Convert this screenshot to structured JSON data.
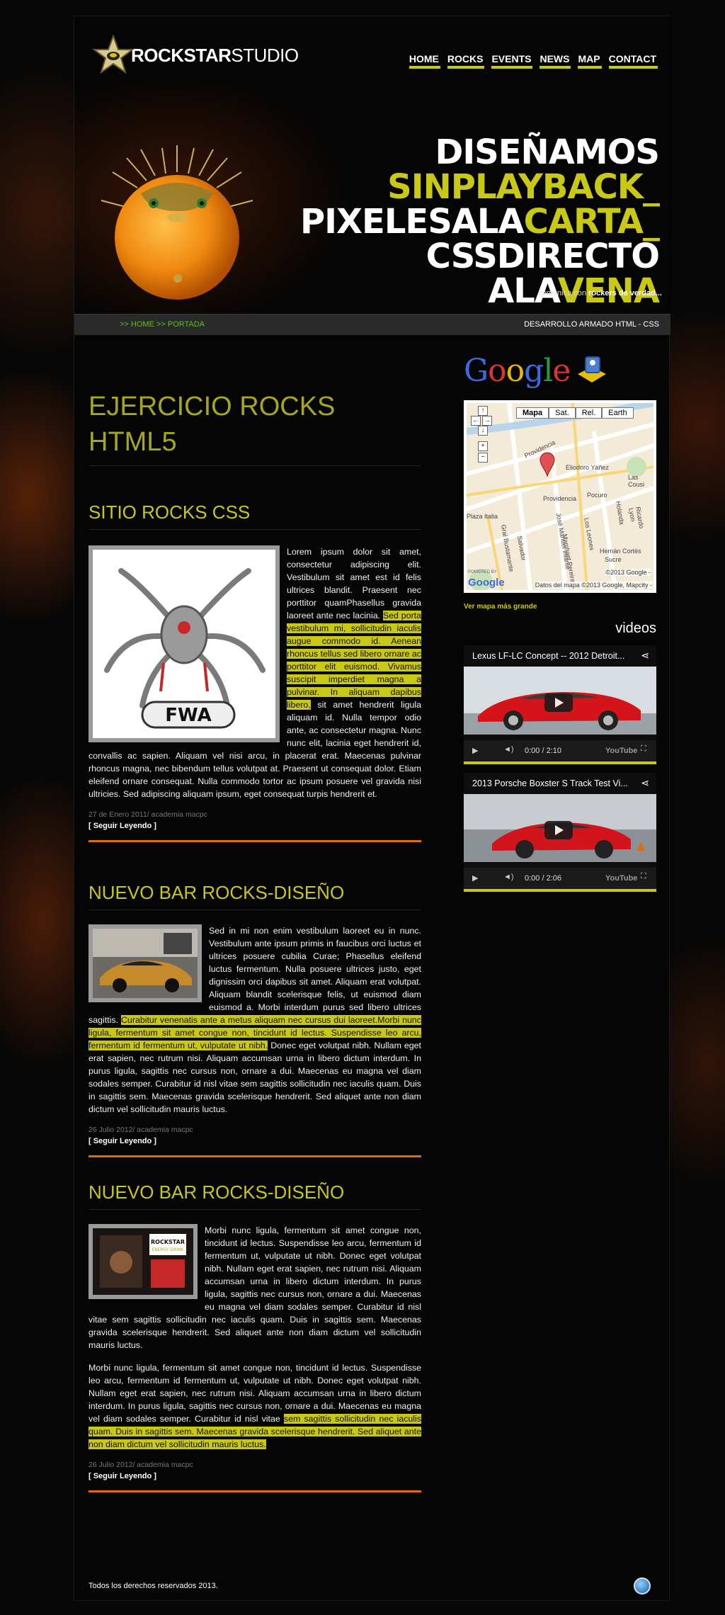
{
  "brand": {
    "logo_part1": "ROCKSTAR",
    "logo_part2": "STUDIO"
  },
  "nav": [
    "HOME",
    "ROCKS",
    "EVENTS",
    "NEWS",
    "MAP",
    "CONTACT"
  ],
  "tagline": {
    "line1": "DISEÑAMOS",
    "line2": "SINPLAYBACK_",
    "line3a": "PIXELESALA",
    "line3b": "CARTA_",
    "line4": "CSSDIRECTO",
    "line5a": "ALA",
    "line5b": "VENA",
    "sub_prefix": "comunica con ",
    "sub_bold": "rockers de verdad..."
  },
  "breadcrumb": {
    "left": ">> HOME >> PORTADA",
    "right": "DESARROLLO ARMADO HTML - CSS"
  },
  "page_title": "EJERCICIO ROCKS HTML5",
  "posts": [
    {
      "title": "SITIO ROCKS CSS",
      "text_before": "Lorem ipsum dolor sit amet, consectetur adipiscing elit. Vestibulum sit amet est id felis ultrices blandit. Praesent nec porttitor quamPhasellus gravida laoreet ante nec lacinia. ",
      "text_highlight": "Sed porta vestibulum mi, sollicitudin iaculis augue commodo id. Aenean rhoncus tellus sed libero ornare ac porttitor elit euismod. Vivamus suscipit imperdiet magna a pulvinar. In aliquam dapibus libero,",
      "text_after": " sit amet hendrerit ligula aliquam id. Nulla tempor odio ante, ac consectetur magna. Nunc nunc elit, lacinia eget hendrerit id, convallis ac sapien. Aliquam vel nisi arcu, in placerat erat. Maecenas pulvinar rhoncus magna, nec bibendum tellus volutpat at. Praesent ut consequat dolor. Etiam eleifend ornare consequat. Nulla commodo tortor ac ipsum posuere vel gravida nisi ultricies. Sed adipiscing aliquam ipsum, eget consequat turpis hendrerit et.",
      "meta": "27 de Enero 2011/ academia macpc",
      "more": "[ Seguir Leyendo ]"
    },
    {
      "title": "NUEVO BAR ROCKS-DISEÑO",
      "text_before": "Sed in mi non enim vestibulum laoreet eu in nunc. Vestibulum ante ipsum primis in faucibus orci luctus et ultrices posuere cubilia Curae; Phasellus eleifend luctus fermentum. Nulla posuere ultrices justo, eget dignissim orci dapibus sit amet. Aliquam erat volutpat. Aliquam blandit scelerisque felis, ut euismod diam euismod a. Morbi interdum purus sed libero ultrices sagittis. ",
      "text_highlight": "Curabitur venenatis ante a metus aliquam nec cursus dui laoreet.Morbi nunc ligula, fermentum sit amet congue non, tincidunt id lectus. Suspendisse leo arcu, fermentum id fermentum ut, vulputate ut nibh.",
      "text_after": " Donec eget volutpat nibh. Nullam eget erat sapien, nec rutrum nisi. Aliquam accumsan urna in libero dictum interdum. In purus ligula, sagittis nec cursus non, ornare a dui. Maecenas eu magna vel diam sodales semper. Curabitur id nisl vitae sem sagittis sollicitudin nec iaculis quam. Duis in sagittis sem. Maecenas gravida scelerisque hendrerit. Sed aliquet ante non diam dictum vel sollicitudin mauris luctus.",
      "meta": "26 Julio 2012/ academia macpc",
      "more": "[ Seguir Leyendo ]"
    },
    {
      "title": "NUEVO BAR ROCKS-DISEÑO",
      "text_p1": "Morbi nunc ligula, fermentum sit amet congue non, tincidunt id lectus. Suspendisse leo arcu, fermentum id fermentum ut, vulputate ut nibh. Donec eget volutpat nibh. Nullam eget erat sapien, nec rutrum nisi. Aliquam accumsan urna in libero dictum interdum. In purus ligula, sagittis nec cursus non, ornare a dui. Maecenas eu magna vel diam sodales semper. Curabitur id nisl vitae sem sagittis sollicitudin nec iaculis quam. Duis in sagittis sem. Maecenas gravida scelerisque hendrerit. Sed aliquet ante non diam dictum vel sollicitudin mauris luctus.",
      "text_before": "Morbi nunc ligula, fermentum sit amet congue non, tincidunt id lectus. Suspendisse leo arcu, fermentum id fermentum ut, vulputate ut nibh. Donec eget volutpat nibh. Nullam eget erat sapien, nec rutrum nisi. Aliquam accumsan urna in libero dictum interdum. In purus ligula, sagittis nec cursus non, ornare a dui. Maecenas eu magna vel diam sodales semper. Curabitur id nisl vitae ",
      "text_highlight": "sem sagittis sollicitudin nec iaculis quam. Duis in sagittis sem. Maecenas gravida scelerisque hendrerit. Sed aliquet ante non diam dictum vel sollicitudin mauris luctus.",
      "meta": "26 Julio 2012/ academia macpc",
      "more": "[ Seguir Leyendo ]"
    }
  ],
  "sidebar": {
    "google": "Google",
    "map_buttons": [
      "Mapa",
      "Sat.",
      "Rel.",
      "Earth"
    ],
    "map_labels": [
      "Providencia",
      "Eliodoro Yáñez",
      "Plaza Italia",
      "Providencia",
      "Pocuro",
      "Hernán Cortés",
      "Sucre",
      "Gral Bustamante",
      "José Manuel Infante",
      "Salvador",
      "Holanda",
      "Ricardo Lyon",
      "Marchant Pereira",
      "Los Leones",
      "Las Cousi"
    ],
    "map_credit": "©2013 Google -",
    "map_data": "Datos del mapa ©2013 Google, Mapcity -",
    "map_powered": "POWERED BY",
    "map_link": "Ver mapa más grande",
    "videos_heading": "videos",
    "videos": [
      {
        "title": "Lexus LF-LC Concept -- 2012 Detroit...",
        "time": "0:00 / 2:10"
      },
      {
        "title": "2013 Porsche Boxster S Track Test Vi...",
        "time": "0:00 / 2:06"
      }
    ],
    "youtube": "YouTube"
  },
  "footer": {
    "copyright": "Todos los derechos reservados 2013."
  },
  "colors": {
    "accent": "#c9c815",
    "orange_rule": "#e06a10",
    "title_olive": "#a5a81a",
    "crumb_green": "#5fbf24"
  }
}
